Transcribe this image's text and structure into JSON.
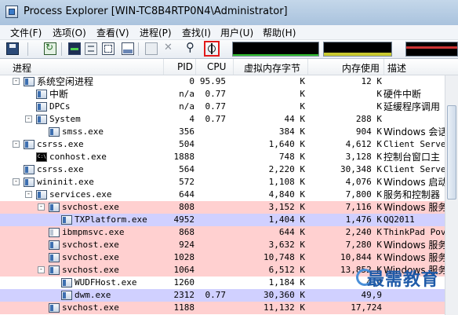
{
  "window": {
    "title": "Process Explorer [WIN-TC8B4RTP0N4\\Administrator]"
  },
  "menu": [
    "文件(F)",
    "选项(O)",
    "查看(V)",
    "进程(P)",
    "查找(I)",
    "用户(U)",
    "帮助(H)"
  ],
  "toolbar": {
    "buttons": [
      "save-icon",
      "refresh-icon",
      "system-info-icon",
      "properties-icon",
      "tree-view-icon",
      "lower-pane-icon",
      "dll-view-icon",
      "kill-process-icon",
      "find-icon",
      "target-crosshair-icon"
    ],
    "highlighted": "target-crosshair-icon",
    "highlight_color": "#e21a1a"
  },
  "columns": {
    "name": "进程",
    "pid": "PID",
    "cpu": "CPU",
    "vmem": "虚拟内存字节",
    "wset": "内存使用",
    "desc": "描述"
  },
  "colors": {
    "service": "#ffd0d0",
    "own_process": "#d0d0ff",
    "default": "#ffffff"
  },
  "rows": [
    {
      "name": "系统空闲进程",
      "depth": 0,
      "toggle": "-",
      "icon": "window",
      "pid": "0",
      "cpu": "95.95",
      "vmem": "K",
      "wset": "12 K",
      "desc": "",
      "bg": "default"
    },
    {
      "name": "中断",
      "depth": 1,
      "toggle": "",
      "icon": "window",
      "pid": "n/a",
      "cpu": "0.77",
      "vmem": "K",
      "wset": "K",
      "desc": "硬件中断",
      "bg": "default"
    },
    {
      "name": "DPCs",
      "depth": 1,
      "toggle": "",
      "icon": "window",
      "pid": "n/a",
      "cpu": "0.77",
      "vmem": "K",
      "wset": "K",
      "desc": "延缓程序调用",
      "bg": "default"
    },
    {
      "name": "System",
      "depth": 1,
      "toggle": "-",
      "icon": "window",
      "pid": "4",
      "cpu": "0.77",
      "vmem": "44 K",
      "wset": "288 K",
      "desc": "",
      "bg": "default"
    },
    {
      "name": "smss.exe",
      "depth": 2,
      "toggle": "",
      "icon": "window",
      "pid": "356",
      "cpu": "",
      "vmem": "384 K",
      "wset": "904 K",
      "desc": "Windows 会话",
      "bg": "default"
    },
    {
      "name": "csrss.exe",
      "depth": 0,
      "toggle": "-",
      "icon": "window",
      "pid": "504",
      "cpu": "",
      "vmem": "1,640 K",
      "wset": "4,612 K",
      "desc": "Client Serve",
      "bg": "default"
    },
    {
      "name": "conhost.exe",
      "depth": 1,
      "toggle": "",
      "icon": "console",
      "pid": "1888",
      "cpu": "",
      "vmem": "748 K",
      "wset": "3,128 K",
      "desc": "控制台窗口主",
      "bg": "default"
    },
    {
      "name": "csrss.exe",
      "depth": 0,
      "toggle": "",
      "icon": "window",
      "pid": "564",
      "cpu": "",
      "vmem": "2,220 K",
      "wset": "30,348 K",
      "desc": "Client Serve",
      "bg": "default"
    },
    {
      "name": "wininit.exe",
      "depth": 0,
      "toggle": "-",
      "icon": "window",
      "pid": "572",
      "cpu": "",
      "vmem": "1,108 K",
      "wset": "4,076 K",
      "desc": "Windows 启动",
      "bg": "default"
    },
    {
      "name": "services.exe",
      "depth": 1,
      "toggle": "-",
      "icon": "window",
      "pid": "644",
      "cpu": "",
      "vmem": "4,840 K",
      "wset": "7,800 K",
      "desc": "服务和控制器",
      "bg": "default"
    },
    {
      "name": "svchost.exe",
      "depth": 2,
      "toggle": "-",
      "icon": "window",
      "pid": "808",
      "cpu": "",
      "vmem": "3,152 K",
      "wset": "7,116 K",
      "desc": "Windows 服务",
      "bg": "service"
    },
    {
      "name": "TXPlatform.exe",
      "depth": 3,
      "toggle": "",
      "icon": "window",
      "pid": "4952",
      "cpu": "",
      "vmem": "1,404 K",
      "wset": "1,476 K",
      "desc": "QQ2011",
      "bg": "own_process"
    },
    {
      "name": "ibmpmsvc.exe",
      "depth": 2,
      "toggle": "",
      "icon": "blank",
      "pid": "868",
      "cpu": "",
      "vmem": "644 K",
      "wset": "2,240 K",
      "desc": "ThinkPad Pov",
      "bg": "service"
    },
    {
      "name": "svchost.exe",
      "depth": 2,
      "toggle": "",
      "icon": "window",
      "pid": "924",
      "cpu": "",
      "vmem": "3,632 K",
      "wset": "7,280 K",
      "desc": "Windows 服务",
      "bg": "service"
    },
    {
      "name": "svchost.exe",
      "depth": 2,
      "toggle": "",
      "icon": "window",
      "pid": "1028",
      "cpu": "",
      "vmem": "10,748 K",
      "wset": "10,844 K",
      "desc": "Windows 服务",
      "bg": "service"
    },
    {
      "name": "svchost.exe",
      "depth": 2,
      "toggle": "-",
      "icon": "window",
      "pid": "1064",
      "cpu": "",
      "vmem": "6,512 K",
      "wset": "13,852 K",
      "desc": "Windows 服务",
      "bg": "service"
    },
    {
      "name": "WUDFHost.exe",
      "depth": 3,
      "toggle": "",
      "icon": "window",
      "pid": "1260",
      "cpu": "",
      "vmem": "1,184 K",
      "wset": "4,4",
      "desc": "",
      "bg": "default"
    },
    {
      "name": "dwm.exe",
      "depth": 3,
      "toggle": "",
      "icon": "window",
      "pid": "2312",
      "cpu": "0.77",
      "vmem": "30,360 K",
      "wset": "49,9",
      "desc": "",
      "bg": "own_process"
    },
    {
      "name": "svchost.exe",
      "depth": 2,
      "toggle": "",
      "icon": "window",
      "pid": "1188",
      "cpu": "",
      "vmem": "11,132 K",
      "wset": "17,724",
      "desc": "",
      "bg": "service"
    }
  ],
  "watermark": {
    "text": "最需教育"
  }
}
